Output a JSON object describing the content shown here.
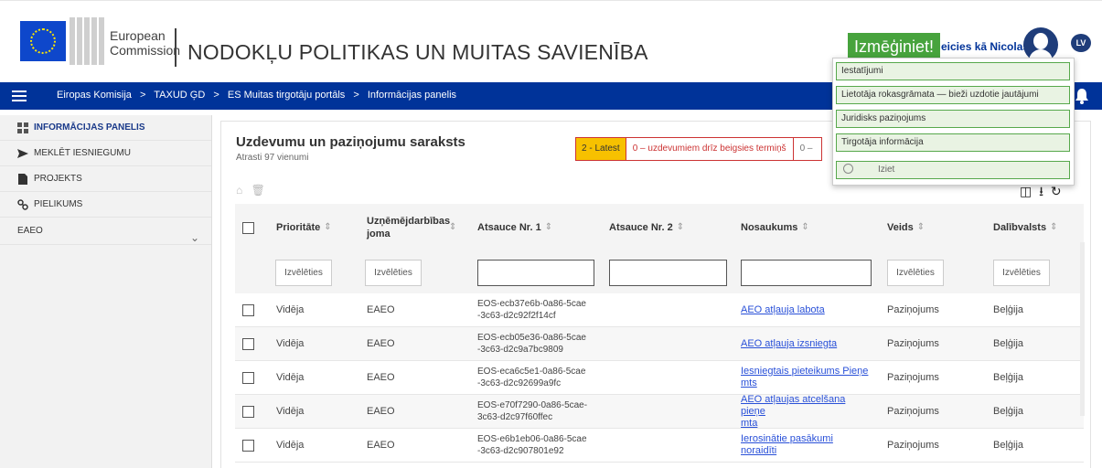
{
  "header": {
    "logo_line1": "European",
    "logo_line2": "Commission",
    "site_title": "NODOKĻU POLITIKAS UN MUITAS SAVIENĪBA",
    "greet_button": "Izmēģiniet!",
    "user_name": "eicies kā Nicolas",
    "language": "LV"
  },
  "nav": {
    "breadcrumbs": [
      "Eiropas Komisija",
      "TAXUD ĢD",
      "ES Muitas tirgotāju portāls",
      "Informācijas panelis"
    ],
    "separator": ">"
  },
  "sidebar": {
    "items": [
      {
        "label": "INFORMĀCIJAS PANELIS",
        "icon": "dashboard-icon"
      },
      {
        "label": "MEKLĒT IESNIEGUMU",
        "icon": "send-icon"
      },
      {
        "label": "PROJEKTS",
        "icon": "document-icon"
      },
      {
        "label": "PIELIKUMS",
        "icon": "link-icon"
      },
      {
        "label": "EAEO",
        "icon": "chevron-down-icon"
      }
    ]
  },
  "main": {
    "title": "Uzdevumu un paziņojumu saraksts",
    "subtitle": "Atrasti 97 vienumi",
    "filters": {
      "latest": "2 - Latest",
      "deadline": "0 – uzdevumiem drīz beigsies termiņš",
      "other": "0 –"
    },
    "columns": [
      "Prioritāte",
      "Uzņēmējdarbības joma",
      "Atsauce Nr. 1",
      "Atsauce Nr. 2",
      "Nosaukums",
      "Veids",
      "Dalībvalsts"
    ],
    "select_placeholder": "Izvēlēties",
    "rows": [
      {
        "priority": "Vidēja",
        "domain": "EAEO",
        "ref1_a": "EOS-ecb37e6b-0a86-5cae",
        "ref1_b": "-3c63-d2c92f2f14cf",
        "title_a": "AEO atļauja labota",
        "title_b": "",
        "type": "Paziņojums",
        "country": "Beļģija"
      },
      {
        "priority": "Vidēja",
        "domain": "EAEO",
        "ref1_a": "EOS-ecb05e36-0a86-5cae",
        "ref1_b": "-3c63-d2c9a7bc9809",
        "title_a": "AEO atļauja izsniegta",
        "title_b": "",
        "type": "Paziņojums",
        "country": "Beļģija"
      },
      {
        "priority": "Vidēja",
        "domain": "EAEO",
        "ref1_a": "EOS-eca6c5e1-0a86-5cae",
        "ref1_b": "-3c63-d2c92699a9fc",
        "title_a": "Iesniegtais pieteikums Pieņe",
        "title_b": "mts",
        "type": "Paziņojums",
        "country": "Beļģija"
      },
      {
        "priority": "Vidēja",
        "domain": "EAEO",
        "ref1_a": "EOS-e70f7290-0a86-5cae-",
        "ref1_b": "3c63-d2c97f60ffec",
        "title_a": "AEO atļaujas atcelšana pieņe",
        "title_b": "mta",
        "type": "Paziņojums",
        "country": "Beļģija"
      },
      {
        "priority": "Vidēja",
        "domain": "EAEO",
        "ref1_a": "EOS-e6b1eb06-0a86-5cae",
        "ref1_b": "-3c63-d2c907801e92",
        "title_a": "Ierosinātie pasākumi noraidīti",
        "title_b": "",
        "type": "Paziņojums",
        "country": "Beļģija"
      }
    ]
  },
  "menu": {
    "items": [
      "Iestatījumi",
      "Lietotāja rokasgrāmata — bieži uzdotie jautājumi",
      "Juridisks paziņojums",
      "Tirgotāja informācija"
    ],
    "logout": "Iziet"
  },
  "colors": {
    "nav_blue": "#003399",
    "accent_green": "#47a33d",
    "latest_yellow": "#f7c100",
    "deadline_red": "#cc3333",
    "link_blue": "#2950d8"
  }
}
